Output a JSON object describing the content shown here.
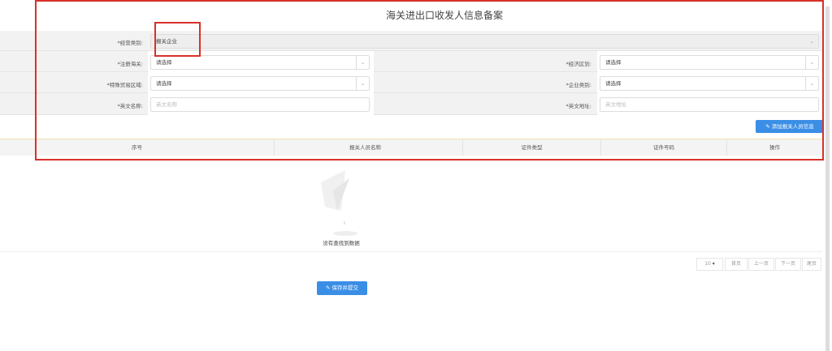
{
  "title": "海关进出口收发人信息备案",
  "form": {
    "business_type": {
      "label": "*经营类别:",
      "value": "报关企业"
    },
    "customs": {
      "label": "*注册海关:",
      "value": "请选择"
    },
    "special_zone": {
      "label": "*特殊贸易区域:",
      "value": "请选择"
    },
    "english_name": {
      "label": "*英文名称:",
      "placeholder": "英文名称"
    },
    "economic_zone": {
      "label": "*经济区划:",
      "value": "请选择"
    },
    "company_type": {
      "label": "*企业类别:",
      "value": "请选择"
    },
    "english_address": {
      "label": "*英文地址:",
      "placeholder": "英文地址"
    }
  },
  "add_button": "添加报关人员信息",
  "table": {
    "headers": [
      "序号",
      "报关人员名称",
      "证件类型",
      "证件号码",
      "操作"
    ],
    "empty_text": "没有查找到数据"
  },
  "pagination": {
    "page_size": "10",
    "first": "首页",
    "prev": "上一页",
    "next": "下一页",
    "last": "尾页"
  },
  "save_button": "保存并提交",
  "colors": {
    "highlight": "#d9302a",
    "primary": "#3a8ee6"
  }
}
